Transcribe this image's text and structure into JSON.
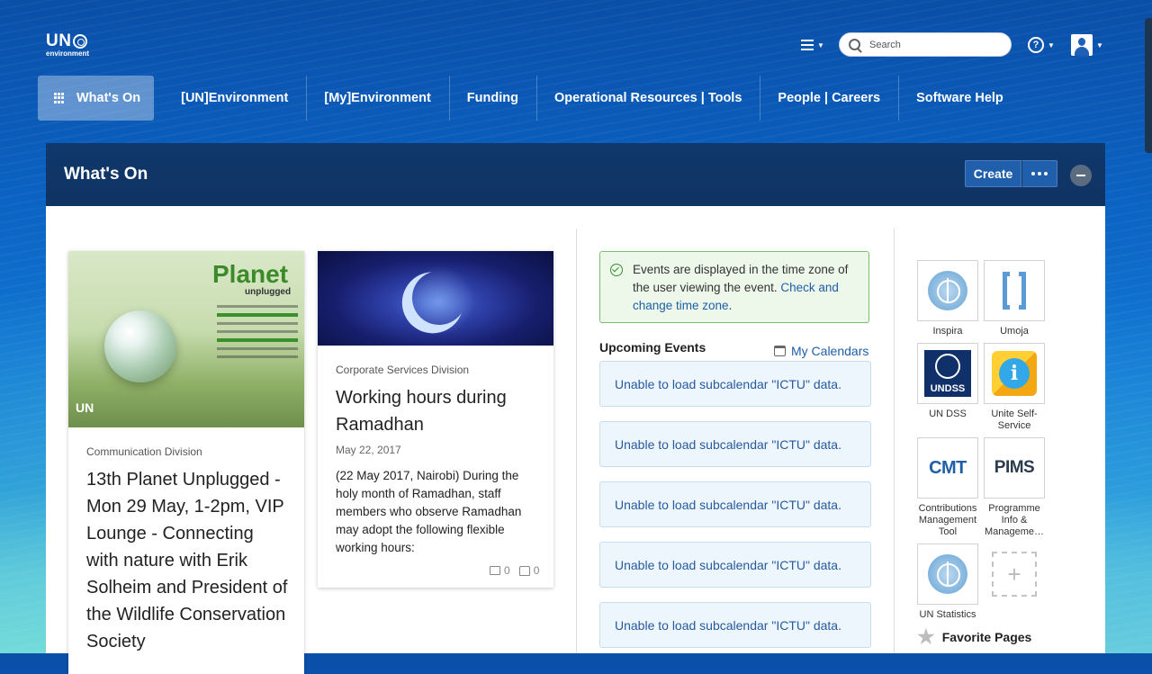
{
  "logo": {
    "main": "UN",
    "sub": "environment"
  },
  "search": {
    "placeholder": "Search"
  },
  "nav": {
    "items": [
      {
        "label": "What's On"
      },
      {
        "label": "[UN]Environment"
      },
      {
        "label": "[My]Environment"
      },
      {
        "label": "Funding"
      },
      {
        "label": "Operational Resources | Tools"
      },
      {
        "label": "People | Careers"
      },
      {
        "label": "Software Help"
      }
    ]
  },
  "header": {
    "title": "What's On",
    "create_label": "Create"
  },
  "cards": [
    {
      "image_title": "Planet",
      "image_subtitle": "unplugged",
      "division": "Communication Division",
      "title": "13th Planet Unplugged - Mon 29 May, 1-2pm, VIP Lounge - Connecting with nature with Erik Solheim and President of the Wildlife Conservation Society"
    },
    {
      "division": "Corporate Services Division",
      "title": "Working hours during Ramadhan",
      "date": "May 22, 2017",
      "body": "(22 May 2017, Nairobi) During the holy month of Ramadhan, staff members who observe Ramadhan may adopt the following flexible working hours:",
      "comments": "0",
      "likes": "0"
    }
  ],
  "events": {
    "tz_note": "Events are displayed in the time zone of the user viewing the event.",
    "tz_link": "Check and change time zone",
    "tz_end": ".",
    "heading": "Upcoming Events",
    "my_calendars": "My Calendars",
    "items": [
      "Unable to load subcalendar \"ICTU\" data.",
      "Unable to load subcalendar \"ICTU\" data.",
      "Unable to load subcalendar \"ICTU\" data.",
      "Unable to load subcalendar \"ICTU\" data.",
      "Unable to load subcalendar \"ICTU\" data."
    ]
  },
  "apps": {
    "items": [
      {
        "label": "Inspira",
        "icon": "un-emblem-icon"
      },
      {
        "label": "Umoja",
        "icon": "umoja-icon"
      },
      {
        "label": "UN DSS",
        "icon": "undss-icon",
        "tile_text": "UNDSS"
      },
      {
        "label": "Unite Self-Service",
        "icon": "unite-icon",
        "tile_text": "i"
      },
      {
        "label": "Contributions Management Tool",
        "icon": "cmt-icon",
        "tile_text": "CMT"
      },
      {
        "label": "Programme Info & Manageme…",
        "icon": "pims-icon",
        "tile_text": "PIMS"
      },
      {
        "label": "UN Statistics",
        "icon": "un-emblem-icon"
      }
    ],
    "favorite_pages": "Favorite Pages"
  }
}
